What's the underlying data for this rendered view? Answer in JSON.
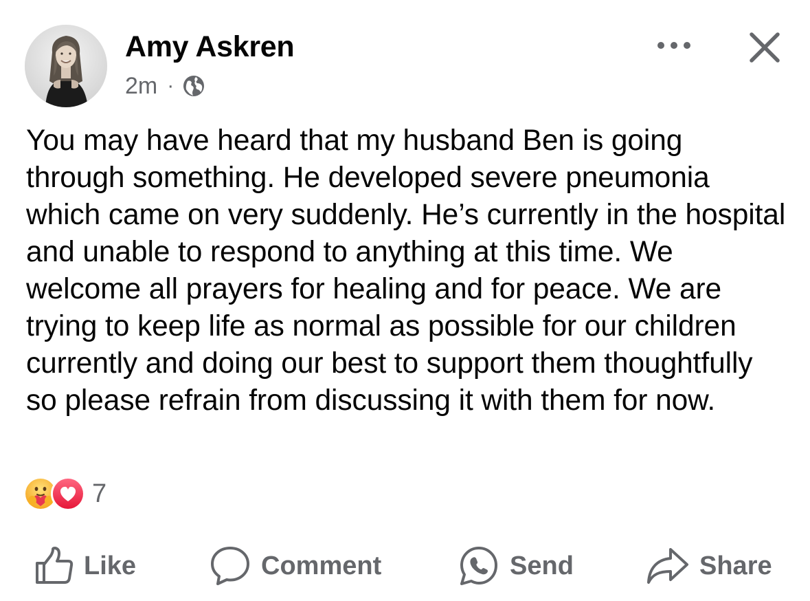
{
  "post": {
    "author": "Amy Askren",
    "timestamp": "2m",
    "separator": "·",
    "audience_icon": "globe-icon",
    "text": "You may have heard that my husband Ben is going through something. He developed severe pneumonia which came on very suddenly. He’s currently in the hospital and unable to respond to anything at this time. We welcome all prayers for healing and for peace. We are trying to keep life as normal as possible for our children currently and doing our best to support them thoughtfully so please refrain from discussing it with them for now.",
    "reactions": {
      "types": [
        "care",
        "love"
      ],
      "count": "7"
    }
  },
  "header_icons": [
    "more-options-icon",
    "close-icon"
  ],
  "actions": {
    "like": "Like",
    "comment": "Comment",
    "send": "Send",
    "share": "Share"
  },
  "colors": {
    "text_primary": "#050505",
    "text_secondary": "#65676b",
    "love_red": "#f33e58",
    "care_yellow": "#f7b125"
  }
}
